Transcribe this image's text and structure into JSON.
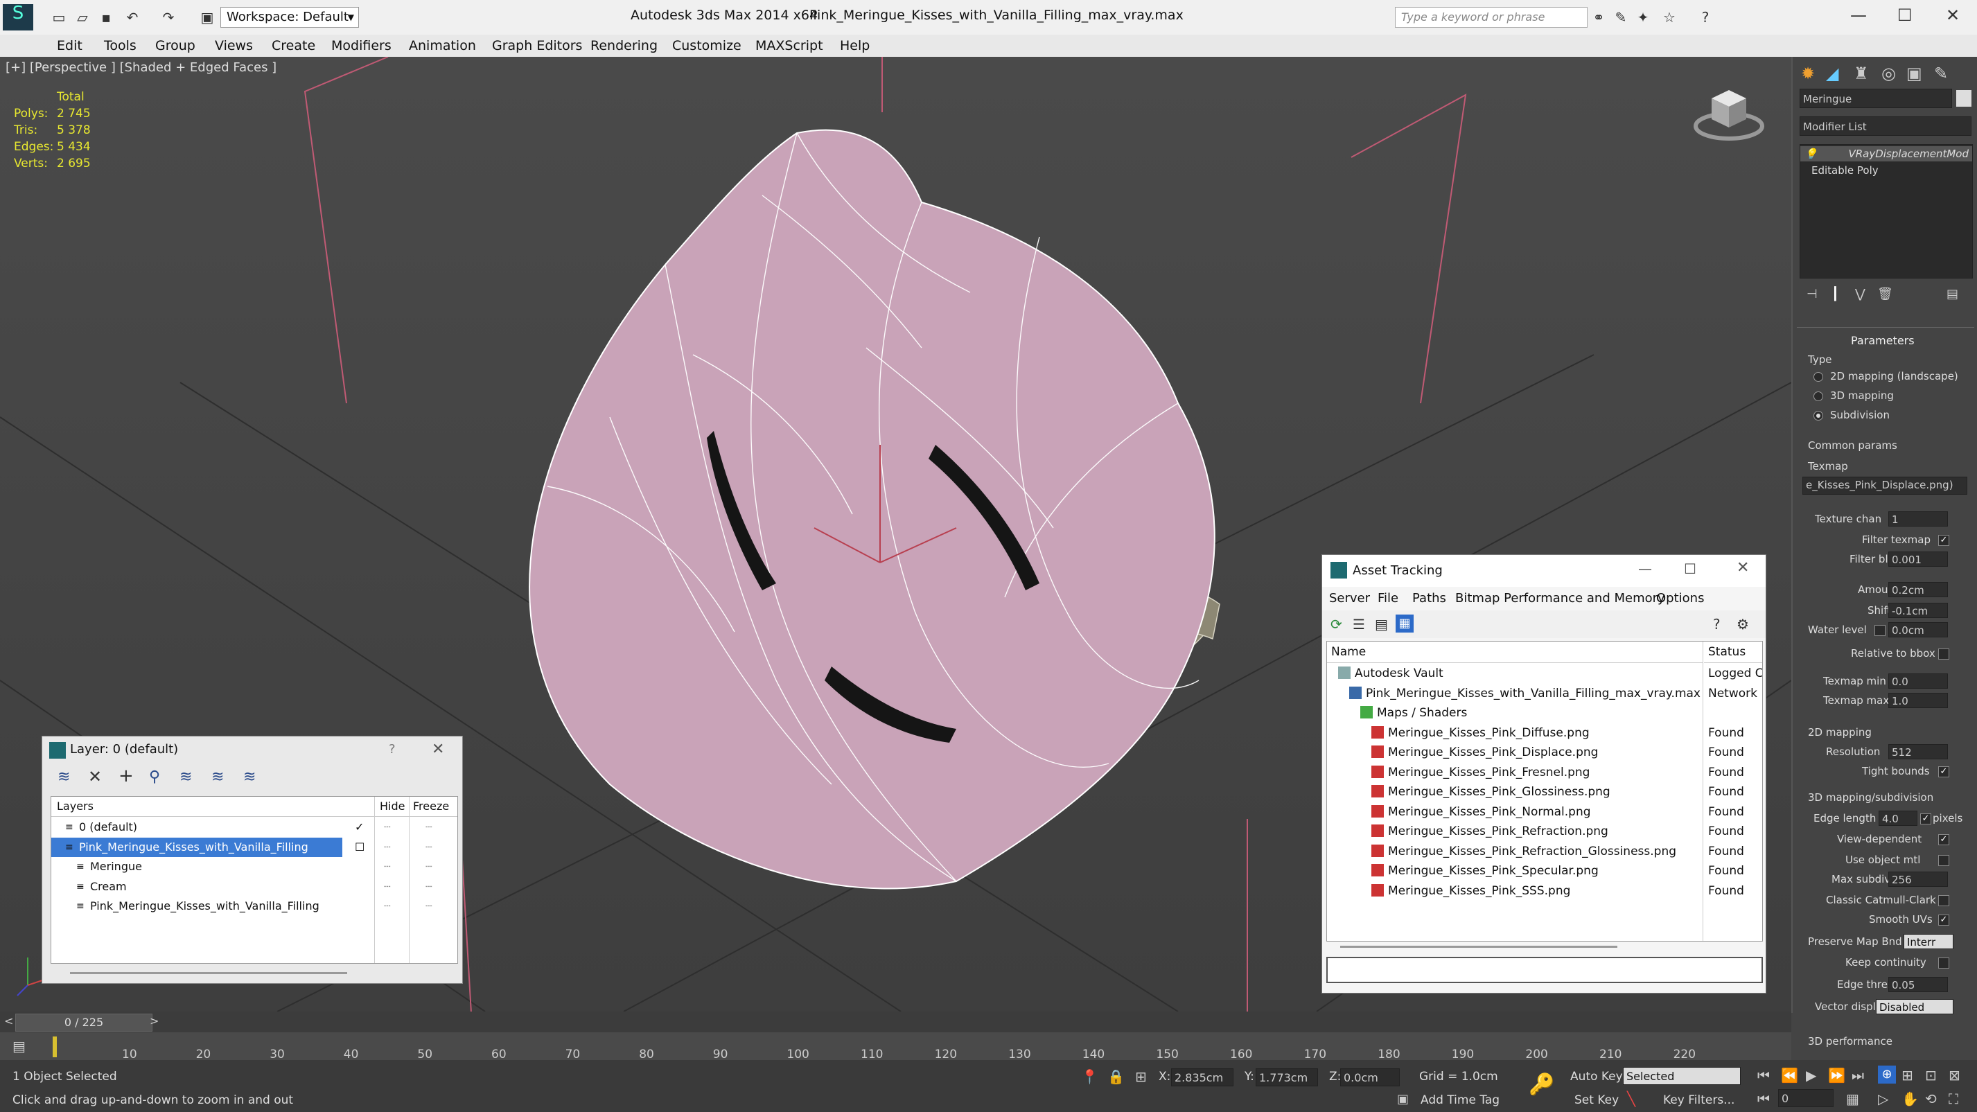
{
  "app": {
    "title": "Autodesk 3ds Max  2014 x64",
    "file": "Pink_Meringue_Kisses_with_Vanilla_Filling_max_vray.max",
    "workspace": "Workspace: Default",
    "search_placeholder": "Type a keyword or phrase"
  },
  "menu": [
    "Edit",
    "Tools",
    "Group",
    "Views",
    "Create",
    "Modifiers",
    "Animation",
    "Graph Editors",
    "Rendering",
    "Customize",
    "MAXScript",
    "Help"
  ],
  "viewport": {
    "label": "[+] [Perspective ] [Shaded + Edged Faces ]",
    "stats": {
      "total_label": "Total",
      "rows": [
        {
          "label": "Polys:",
          "value": "2 745"
        },
        {
          "label": "Tris:",
          "value": "5 378"
        },
        {
          "label": "Edges:",
          "value": "5 434"
        },
        {
          "label": "Verts:",
          "value": "2 695"
        }
      ]
    }
  },
  "command_panel": {
    "object_name": "Meringue",
    "modifier_list": "Modifier List",
    "stack": [
      "VRayDisplacementMod",
      "Editable Poly"
    ],
    "parameters_title": "Parameters",
    "type_label": "Type",
    "type_options": [
      {
        "label": "2D mapping (landscape)",
        "selected": false
      },
      {
        "label": "3D mapping",
        "selected": false
      },
      {
        "label": "Subdivision",
        "selected": true
      }
    ],
    "common_params": "Common params",
    "texmap_label": "Texmap",
    "texmap_value": "e_Kisses_Pink_Displace.png)",
    "texture_chan_label": "Texture chan",
    "texture_chan_value": "1",
    "filter_texmap": "Filter texmap",
    "filter_blur_label": "Filter blur",
    "filter_blur_value": "0.001",
    "amount_label": "Amount",
    "amount_value": "0.2cm",
    "shift_label": "Shift",
    "shift_value": "-0.1cm",
    "water_level_label": "Water level",
    "water_level_value": "0.0cm",
    "relative_to_bbox": "Relative to bbox",
    "texmap_min_label": "Texmap min",
    "texmap_min_value": "0.0",
    "texmap_max_label": "Texmap max",
    "texmap_max_value": "1.0",
    "mapping2d": "2D mapping",
    "resolution_label": "Resolution",
    "resolution_value": "512",
    "tight_bounds": "Tight bounds",
    "mapping3d": "3D mapping/subdivision",
    "edge_length_label": "Edge length",
    "edge_length_value": "4.0",
    "pixels": "pixels",
    "view_dependent": "View-dependent",
    "use_object_mtl": "Use object mtl",
    "max_subdivs_label": "Max subdivs",
    "max_subdivs_value": "256",
    "classic_catmull": "Classic Catmull-Clark",
    "smooth_uvs": "Smooth UVs",
    "preserve_map_label": "Preserve Map Bnd",
    "preserve_map_value": "Interr",
    "keep_continuity": "Keep continuity",
    "edge_thresh_label": "Edge thresh",
    "edge_thresh_value": "0.05",
    "vector_disp_label": "Vector displ",
    "vector_disp_value": "Disabled",
    "performance": "3D performance"
  },
  "asset_tracking": {
    "title": "Asset Tracking",
    "menu": [
      "Server",
      "File",
      "Paths",
      "Bitmap Performance and Memory",
      "Options"
    ],
    "col_name": "Name",
    "col_status": "Status",
    "rows": [
      {
        "name": "Autodesk Vault",
        "status": "Logged C",
        "indent": 1,
        "kind": "vault"
      },
      {
        "name": "Pink_Meringue_Kisses_with_Vanilla_Filling_max_vray.max",
        "status": "Network I",
        "indent": 2,
        "kind": "max"
      },
      {
        "name": "Maps / Shaders",
        "status": "",
        "indent": 3,
        "kind": "folder"
      },
      {
        "name": "Meringue_Kisses_Pink_Diffuse.png",
        "status": "Found",
        "indent": 4,
        "kind": "png"
      },
      {
        "name": "Meringue_Kisses_Pink_Displace.png",
        "status": "Found",
        "indent": 4,
        "kind": "png"
      },
      {
        "name": "Meringue_Kisses_Pink_Fresnel.png",
        "status": "Found",
        "indent": 4,
        "kind": "png"
      },
      {
        "name": "Meringue_Kisses_Pink_Glossiness.png",
        "status": "Found",
        "indent": 4,
        "kind": "png"
      },
      {
        "name": "Meringue_Kisses_Pink_Normal.png",
        "status": "Found",
        "indent": 4,
        "kind": "png"
      },
      {
        "name": "Meringue_Kisses_Pink_Refraction.png",
        "status": "Found",
        "indent": 4,
        "kind": "png"
      },
      {
        "name": "Meringue_Kisses_Pink_Refraction_Glossiness.png",
        "status": "Found",
        "indent": 4,
        "kind": "png"
      },
      {
        "name": "Meringue_Kisses_Pink_Specular.png",
        "status": "Found",
        "indent": 4,
        "kind": "png"
      },
      {
        "name": "Meringue_Kisses_Pink_SSS.png",
        "status": "Found",
        "indent": 4,
        "kind": "png"
      }
    ]
  },
  "layer_dialog": {
    "title": "Layer: 0 (default)",
    "help": "?",
    "col_layers": "Layers",
    "col_hide": "Hide",
    "col_freeze": "Freeze",
    "rows": [
      {
        "name": "0 (default)",
        "indent": 1,
        "selected": false
      },
      {
        "name": "Pink_Meringue_Kisses_with_Vanilla_Filling",
        "indent": 1,
        "selected": true
      },
      {
        "name": "Meringue",
        "indent": 2,
        "selected": false
      },
      {
        "name": "Cream",
        "indent": 2,
        "selected": false
      },
      {
        "name": "Pink_Meringue_Kisses_with_Vanilla_Filling",
        "indent": 2,
        "selected": false
      }
    ]
  },
  "timeline": {
    "frame": "0 / 225",
    "ticks": [
      "10",
      "20",
      "30",
      "40",
      "50",
      "60",
      "70",
      "80",
      "90",
      "100",
      "110",
      "120",
      "130",
      "140",
      "150",
      "160",
      "170",
      "180",
      "190",
      "200",
      "210",
      "220"
    ]
  },
  "status": {
    "selected": "1 Object Selected",
    "hint": "Click and drag up-and-down to zoom in and out",
    "x_label": "X:",
    "x_value": "2.835cm",
    "y_label": "Y:",
    "y_value": "1.773cm",
    "z_label": "Z:",
    "z_value": "0.0cm",
    "grid": "Grid = 1.0cm",
    "auto_key": "Auto Key",
    "set_key": "Set Key",
    "selected_mode": "Selected",
    "key_filters": "Key Filters...",
    "add_time_tag": "Add Time Tag",
    "frame_value": "0"
  },
  "colors": {
    "mesh_pink": "#c9a3b8",
    "cream": "#8d8874",
    "selection_blue": "#3b7bd4"
  }
}
